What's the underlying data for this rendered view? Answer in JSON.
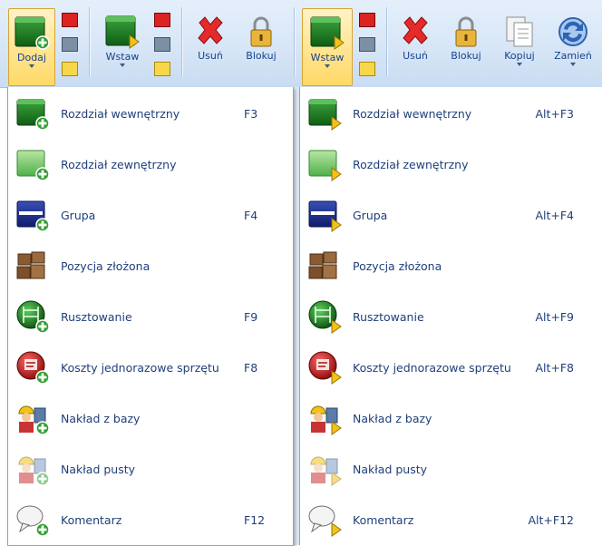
{
  "toolbar_left": {
    "dodaj": "Dodaj",
    "wstaw": "Wstaw",
    "usun": "Usuń",
    "blokuj": "Blokuj"
  },
  "toolbar_right": {
    "wstaw": "Wstaw",
    "usun": "Usuń",
    "blokuj": "Blokuj",
    "kopiuj": "Kopiuj",
    "zamien": "Zamień"
  },
  "menu_left": [
    {
      "label": "Rozdział wewnętrzny",
      "shortcut": "F3",
      "icon": "green-folder-plus-icon"
    },
    {
      "label": "Rozdział zewnętrzny",
      "shortcut": "",
      "icon": "light-green-folder-plus-icon"
    },
    {
      "label": "Grupa",
      "shortcut": "F4",
      "icon": "blue-folder-plus-icon"
    },
    {
      "label": "Pozycja złożona",
      "shortcut": "",
      "icon": "bricks-icon"
    },
    {
      "label": "Rusztowanie",
      "shortcut": "F9",
      "icon": "scaffold-plus-icon"
    },
    {
      "label": "Koszty jednorazowe sprzętu",
      "shortcut": "F8",
      "icon": "equipment-cost-plus-icon"
    },
    {
      "label": "Nakład z bazy",
      "shortcut": "",
      "icon": "worker-database-plus-icon"
    },
    {
      "label": "Nakład pusty",
      "shortcut": "",
      "icon": "worker-empty-plus-icon"
    },
    {
      "label": "Komentarz",
      "shortcut": "F12",
      "icon": "comment-plus-icon"
    }
  ],
  "menu_right": [
    {
      "label": "Rozdział wewnętrzny",
      "shortcut": "Alt+F3",
      "icon": "green-folder-insert-icon"
    },
    {
      "label": "Rozdział zewnętrzny",
      "shortcut": "",
      "icon": "light-green-folder-insert-icon"
    },
    {
      "label": "Grupa",
      "shortcut": "Alt+F4",
      "icon": "blue-folder-insert-icon"
    },
    {
      "label": "Pozycja złożona",
      "shortcut": "",
      "icon": "bricks-icon"
    },
    {
      "label": "Rusztowanie",
      "shortcut": "Alt+F9",
      "icon": "scaffold-insert-icon"
    },
    {
      "label": "Koszty jednorazowe sprzętu",
      "shortcut": "Alt+F8",
      "icon": "equipment-cost-insert-icon"
    },
    {
      "label": "Nakład z bazy",
      "shortcut": "",
      "icon": "worker-database-insert-icon"
    },
    {
      "label": "Nakład pusty",
      "shortcut": "",
      "icon": "worker-empty-insert-icon"
    },
    {
      "label": "Komentarz",
      "shortcut": "Alt+F12",
      "icon": "comment-insert-icon"
    }
  ],
  "colors": {
    "accent": "#15428b",
    "active_button": "#ffd966",
    "ribbon": "#d7e6f7"
  }
}
